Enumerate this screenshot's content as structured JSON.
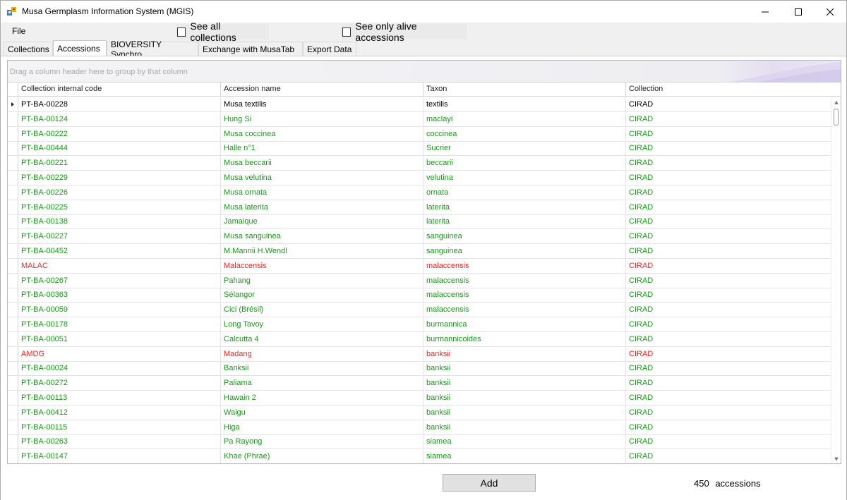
{
  "window": {
    "title": "Musa Germplasm Information System (MGIS)"
  },
  "menu": {
    "file_label": "File"
  },
  "toolbar": {
    "see_all_label": "See all collections",
    "see_alive_label": "See only alive accessions"
  },
  "tabs": [
    {
      "label": "Collections"
    },
    {
      "label": "Accessions"
    },
    {
      "label": "BIOVERSITY Synchro"
    },
    {
      "label": "Exchange with MusaTab"
    },
    {
      "label": "Export Data"
    }
  ],
  "grid": {
    "group_hint": "Drag a column header here to group by that column",
    "columns": [
      "Collection internal code",
      "Accession name",
      "Taxon",
      "Collection"
    ],
    "colors": {
      "normal": "#000000",
      "alive": "#1a9a1a",
      "dead": "#ff2020"
    },
    "rows": [
      {
        "code": "PT-BA-00228",
        "name": "Musa textilis",
        "taxon": "textilis",
        "collection": "CIRAD",
        "status": "normal"
      },
      {
        "code": "PT-BA-00124",
        "name": "Hung Si",
        "taxon": "maclayi",
        "collection": "CIRAD",
        "status": "alive"
      },
      {
        "code": "PT-BA-00222",
        "name": "Musa coccinea",
        "taxon": "coccinea",
        "collection": "CIRAD",
        "status": "alive"
      },
      {
        "code": "PT-BA-00444",
        "name": "Halle n°1",
        "taxon": "Sucrier",
        "collection": "CIRAD",
        "status": "alive"
      },
      {
        "code": "PT-BA-00221",
        "name": "Musa beccarii",
        "taxon": "beccarii",
        "collection": "CIRAD",
        "status": "alive"
      },
      {
        "code": "PT-BA-00229",
        "name": "Musa velutina",
        "taxon": "velutina",
        "collection": "CIRAD",
        "status": "alive"
      },
      {
        "code": "PT-BA-00226",
        "name": "Musa ornata",
        "taxon": "ornata",
        "collection": "CIRAD",
        "status": "alive"
      },
      {
        "code": "PT-BA-00225",
        "name": "Musa laterita",
        "taxon": "laterita",
        "collection": "CIRAD",
        "status": "alive"
      },
      {
        "code": "PT-BA-00138",
        "name": "Jamaique",
        "taxon": "laterita",
        "collection": "CIRAD",
        "status": "alive"
      },
      {
        "code": "PT-BA-00227",
        "name": "Musa sanguinea",
        "taxon": "sanguinea",
        "collection": "CIRAD",
        "status": "alive"
      },
      {
        "code": "PT-BA-00452",
        "name": "M.Mannii H.Wendl",
        "taxon": "sanguinea",
        "collection": "CIRAD",
        "status": "alive"
      },
      {
        "code": "MALAC",
        "name": "Malaccensis",
        "taxon": "malaccensis",
        "collection": "CIRAD",
        "status": "dead"
      },
      {
        "code": "PT-BA-00267",
        "name": "Pahang",
        "taxon": "malaccensis",
        "collection": "CIRAD",
        "status": "alive"
      },
      {
        "code": "PT-BA-00363",
        "name": "Sélangor",
        "taxon": "malaccensis",
        "collection": "CIRAD",
        "status": "alive"
      },
      {
        "code": "PT-BA-00059",
        "name": "Cici (Brésil)",
        "taxon": "malaccensis",
        "collection": "CIRAD",
        "status": "alive"
      },
      {
        "code": "PT-BA-00178",
        "name": "Long Tavoy",
        "taxon": "burmannica",
        "collection": "CIRAD",
        "status": "alive"
      },
      {
        "code": "PT-BA-00051",
        "name": "Calcutta 4",
        "taxon": "burmannicoides",
        "collection": "CIRAD",
        "status": "alive"
      },
      {
        "code": "AMDG",
        "name": "Madang",
        "taxon": "banksii",
        "collection": "CIRAD",
        "status": "dead"
      },
      {
        "code": "PT-BA-00024",
        "name": "Banksii",
        "taxon": "banksii",
        "collection": "CIRAD",
        "status": "alive"
      },
      {
        "code": "PT-BA-00272",
        "name": "Paliama",
        "taxon": "banksii",
        "collection": "CIRAD",
        "status": "alive"
      },
      {
        "code": "PT-BA-00113",
        "name": "Hawain 2",
        "taxon": "banksii",
        "collection": "CIRAD",
        "status": "alive"
      },
      {
        "code": "PT-BA-00412",
        "name": "Waigu",
        "taxon": "banksii",
        "collection": "CIRAD",
        "status": "alive"
      },
      {
        "code": "PT-BA-00115",
        "name": "Higa",
        "taxon": "banksii",
        "collection": "CIRAD",
        "status": "alive"
      },
      {
        "code": "PT-BA-00263",
        "name": "Pa Rayong",
        "taxon": "siamea",
        "collection": "CIRAD",
        "status": "alive"
      },
      {
        "code": "PT-BA-00147",
        "name": "Khae (Phrae)",
        "taxon": "siamea",
        "collection": "CIRAD",
        "status": "alive"
      }
    ]
  },
  "footer": {
    "add_label": "Add",
    "count_value": "450",
    "count_label": "accessions"
  },
  "icons": {
    "app": "app-icon",
    "minimize": "minimize-icon",
    "maximize": "maximize-icon",
    "close": "close-icon",
    "row_indicator": "row-indicator-icon",
    "scroll_up": "scroll-up-icon",
    "scroll_down": "scroll-down-icon"
  }
}
